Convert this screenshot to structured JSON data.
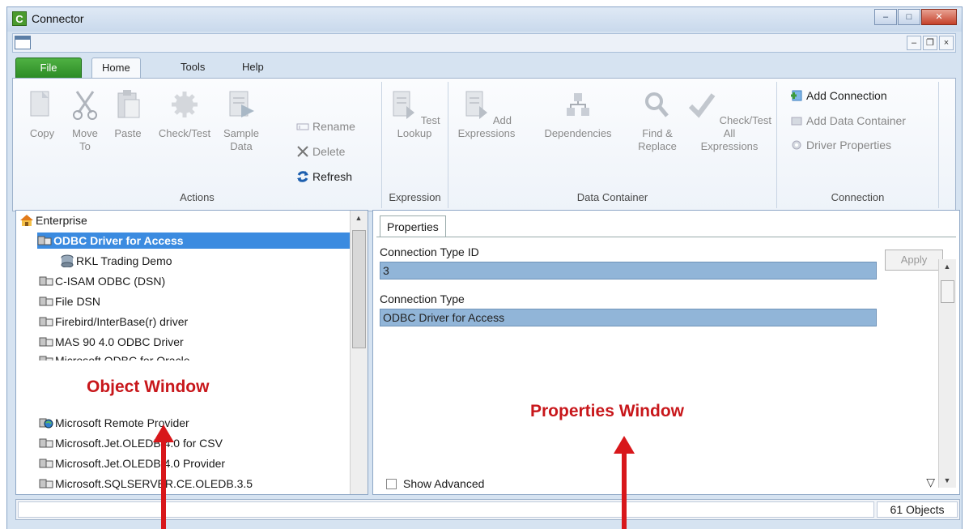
{
  "window": {
    "title": "Connector",
    "app_icon_letter": "C",
    "controls": {
      "minimize": "–",
      "maximize": "□",
      "close": "✕"
    },
    "mdi_controls": {
      "minimize": "–",
      "restore": "❐",
      "close": "×"
    }
  },
  "ribbon": {
    "tabs": {
      "file": "File",
      "home": "Home",
      "tools": "Tools",
      "help": "Help"
    },
    "groups": {
      "actions": {
        "label": "Actions",
        "copy": "Copy",
        "move_to": [
          "Move",
          "To"
        ],
        "paste": "Paste",
        "check_test": "Check/Test",
        "sample_data": [
          "Sample",
          "Data"
        ],
        "rename": "Rename",
        "delete": "Delete",
        "refresh": "Refresh"
      },
      "expression": {
        "label": "Expression",
        "test_lookup": [
          "Test",
          "Lookup"
        ]
      },
      "data_container": {
        "label": "Data Container",
        "add_expressions": [
          "Add",
          "Expressions"
        ],
        "dependencies": "Dependencies",
        "find_replace": [
          "Find &",
          "Replace"
        ],
        "check_test_all": [
          "Check/Test All",
          "Expressions"
        ]
      },
      "connection": {
        "label": "Connection",
        "add_connection": "Add Connection",
        "add_data_container": "Add Data Container",
        "driver_properties": "Driver Properties"
      }
    }
  },
  "tree": {
    "items": [
      {
        "label": "Enterprise",
        "icon": "house-icon"
      },
      {
        "label": "ODBC Driver for Access",
        "icon": "driver-icon"
      },
      {
        "label": "RKL Trading Demo",
        "icon": "database-icon"
      },
      {
        "label": "C-ISAM ODBC (DSN)",
        "icon": "driver-icon"
      },
      {
        "label": "File DSN",
        "icon": "driver-icon"
      },
      {
        "label": "Firebird/InterBase(r) driver",
        "icon": "driver-icon"
      },
      {
        "label": "MAS 90 4.0 ODBC Driver",
        "icon": "driver-icon"
      },
      {
        "label": "Microsoft ODBC for Oracle",
        "icon": "driver-icon"
      },
      {
        "label": "Microsoft Remote Provider",
        "icon": "globe-driver-icon"
      },
      {
        "label": "Microsoft.Jet.OLEDB.4.0 for CSV",
        "icon": "driver-icon"
      },
      {
        "label": "Microsoft.Jet.OLEDB.4.0 Provider",
        "icon": "driver-icon"
      },
      {
        "label": "Microsoft.SQLSERVER.CE.OLEDB.3.5",
        "icon": "driver-icon"
      }
    ]
  },
  "properties": {
    "tab": "Properties",
    "fields": [
      {
        "label": "Connection Type ID",
        "value": "3"
      },
      {
        "label": "Connection Type",
        "value": "ODBC Driver for Access"
      }
    ],
    "apply_label": "Apply",
    "show_advanced": "Show Advanced"
  },
  "status": {
    "count": "61 Objects"
  },
  "annotations": {
    "object_window": "Object Window",
    "properties_window": "Properties Window"
  },
  "colors": {
    "selection": "#3b8be0",
    "field_bg": "#91b5d8",
    "annotation": "#c8171b",
    "file_tab": "#2b8a24"
  }
}
